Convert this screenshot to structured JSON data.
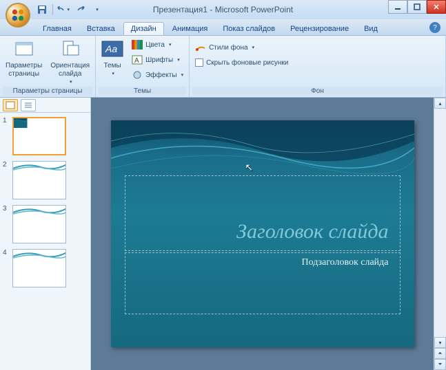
{
  "window": {
    "title": "Презентация1 - Microsoft PowerPoint"
  },
  "qat": {
    "save": "save",
    "undo": "undo",
    "redo": "redo"
  },
  "tabs": {
    "items": [
      "Главная",
      "Вставка",
      "Дизайн",
      "Анимация",
      "Показ слайдов",
      "Рецензирование",
      "Вид"
    ],
    "active_index": 2
  },
  "ribbon": {
    "page_setup": {
      "label": "Параметры страницы",
      "page_params": "Параметры\nстраницы",
      "orientation": "Ориентация\nслайда"
    },
    "themes": {
      "label": "Темы",
      "themes_btn": "Темы",
      "colors": "Цвета",
      "fonts": "Шрифты",
      "effects": "Эффекты"
    },
    "background": {
      "label": "Фон",
      "bg_styles": "Стили фона",
      "hide_bg": "Скрыть фоновые рисунки"
    }
  },
  "slides": {
    "count": 4,
    "selected": 1
  },
  "slide_content": {
    "title": "Заголовок слайда",
    "subtitle": "Подзаголовок слайда"
  },
  "colors": {
    "slide_bg_top": "#0a4d6a",
    "slide_bg_bottom": "#15697f",
    "title_color": "#7fc9d8"
  }
}
